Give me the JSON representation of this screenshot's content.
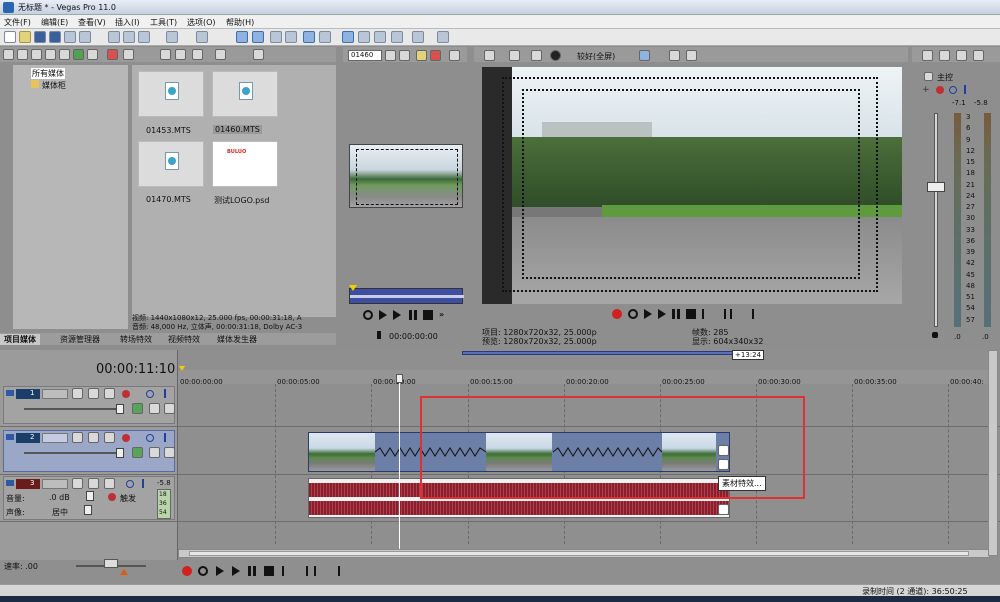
{
  "window": {
    "title": "无标题 * - Vegas Pro 11.0"
  },
  "menu": [
    "文件(F)",
    "编辑(E)",
    "查看(V)",
    "插入(I)",
    "工具(T)",
    "选项(O)",
    "帮助(H)"
  ],
  "explorer": {
    "tree": [
      "所有媒体",
      "媒体柜"
    ],
    "files": [
      {
        "name": "01453.MTS",
        "type": "video"
      },
      {
        "name": "01460.MTS",
        "type": "video"
      },
      {
        "name": "01470.MTS",
        "type": "video"
      },
      {
        "name": "测试LOGO.psd",
        "type": "image"
      }
    ],
    "info_line1": "视频: 1440x1080x12, 25.000 fps, 00:00:31:18, A",
    "info_line2": "音频: 48,000 Hz, 立体声, 00:00:31:18, Dolby AC-3",
    "logo_text": "BULUO",
    "tabs": [
      "项目媒体",
      "资源管理器",
      "转场特效",
      "视频特效",
      "媒体发生器"
    ]
  },
  "trimmer": {
    "clip_select": "01460",
    "timecode": "00:00:00:00"
  },
  "preview": {
    "quality": "较好(全屏)",
    "project_line": "项目: 1280x720x32, 25.000p",
    "preview_line": "预览: 1280x720x32, 25.000p",
    "frame_label": "帧数: 285",
    "display_label": "显示: 604x340x32"
  },
  "master": {
    "title": "主控",
    "left_peak": "-7.1",
    "right_peak": "-5.8",
    "scale": [
      "3",
      "6",
      "9",
      "12",
      "15",
      "18",
      "21",
      "24",
      "27",
      "30",
      "33",
      "36",
      "39",
      "42",
      "45",
      "48",
      "51",
      "54",
      "57"
    ],
    "left_value": ".0",
    "right_value": ".0"
  },
  "timeline": {
    "cursor_time": "00:00:11:10",
    "loop_badge": "+13:24",
    "ticks": [
      "00:00:00:00",
      "00:00:05:00",
      "00:00:10:00",
      "00:00:15:00",
      "00:00:20:00",
      "00:00:25:00",
      "00:00:30:00",
      "00:00:35:00",
      "00:00:40:"
    ],
    "tracks": [
      {
        "number": "1",
        "kind": "video"
      },
      {
        "number": "2",
        "kind": "video"
      },
      {
        "number": "3",
        "kind": "audio",
        "volume_label": "音量:",
        "volume_value": ".0 dB",
        "pan_label": "声像:",
        "pan_value": "居中",
        "mode": "触发",
        "meter_peak": "-5.8",
        "meter_scale": [
          "18",
          "36",
          "54"
        ]
      }
    ],
    "tooltip": "素材特效...",
    "highlight_color": "#e03030"
  },
  "status": {
    "rate_label": "速率: .00",
    "record_time": "录制时间 (2 通道): 36:50:25"
  }
}
